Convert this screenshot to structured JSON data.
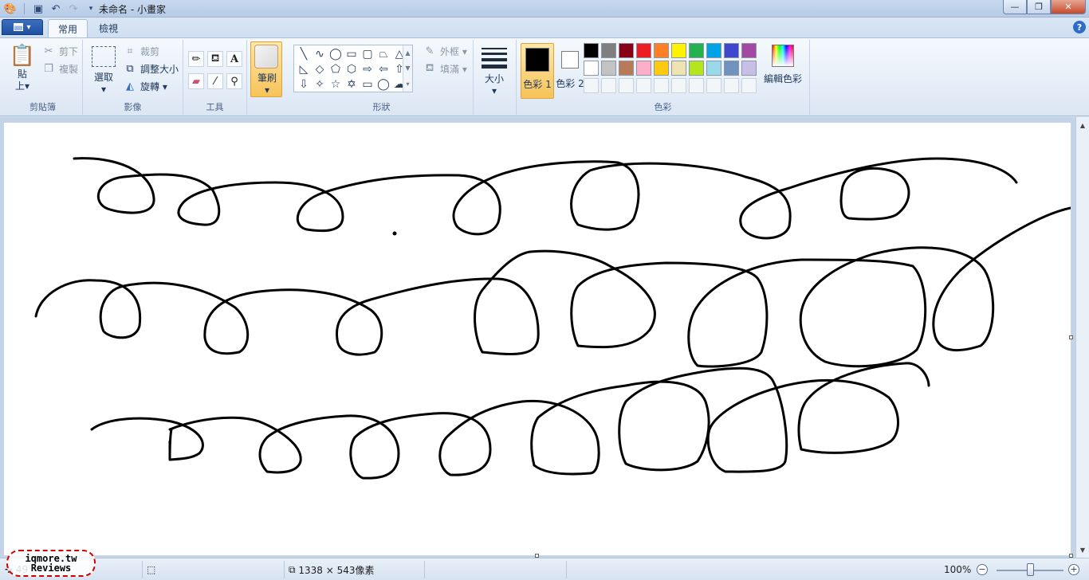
{
  "window": {
    "title": "未命名 - 小畫家",
    "buttons": {
      "minimize": "—",
      "maximize": "❐",
      "close": "✕"
    }
  },
  "qat": {
    "app_icon": "paint-icon",
    "save": "save-icon",
    "undo": "undo-icon",
    "redo": "redo-icon",
    "customize": "dropdown-icon"
  },
  "tabs": {
    "home": "常用",
    "view": "檢視"
  },
  "help": "?",
  "ribbon": {
    "clipboard": {
      "paste": "貼\n上▾",
      "cut": "剪下",
      "copy": "複製",
      "label": "剪貼簿"
    },
    "image": {
      "select": "選取\n▾",
      "crop": "裁剪",
      "resize": "調整大小",
      "rotate": "旋轉 ▾",
      "label": "影像"
    },
    "tools": {
      "label": "工具"
    },
    "brushes": {
      "label": "筆刷\n▾"
    },
    "shapes": {
      "outline": "外框 ▾",
      "fill": "填滿 ▾",
      "label": "形狀"
    },
    "size": {
      "label": "大小\n▾"
    },
    "colors": {
      "color1": "色彩 1",
      "color2": "色彩 2",
      "edit": "編輯色彩",
      "label": "色彩",
      "color1_value": "#000000",
      "color2_value": "#ffffff",
      "palette_row1": [
        "#000000",
        "#7f7f7f",
        "#880015",
        "#ed1c24",
        "#ff7f27",
        "#fff200",
        "#22b14c",
        "#00a2e8",
        "#3f48cc",
        "#a349a4"
      ],
      "palette_row2": [
        "#ffffff",
        "#c3c3c3",
        "#b97a57",
        "#ffaec9",
        "#ffc90e",
        "#efe4b0",
        "#b5e61d",
        "#99d9ea",
        "#7092be",
        "#c8bfe7"
      ]
    }
  },
  "status": {
    "canvas_size": "1338 × 543像素",
    "zoom": "100%",
    "cursor_pos": "49"
  },
  "watermark": {
    "line1": "iqmore.tw",
    "line2": "Reviews"
  }
}
